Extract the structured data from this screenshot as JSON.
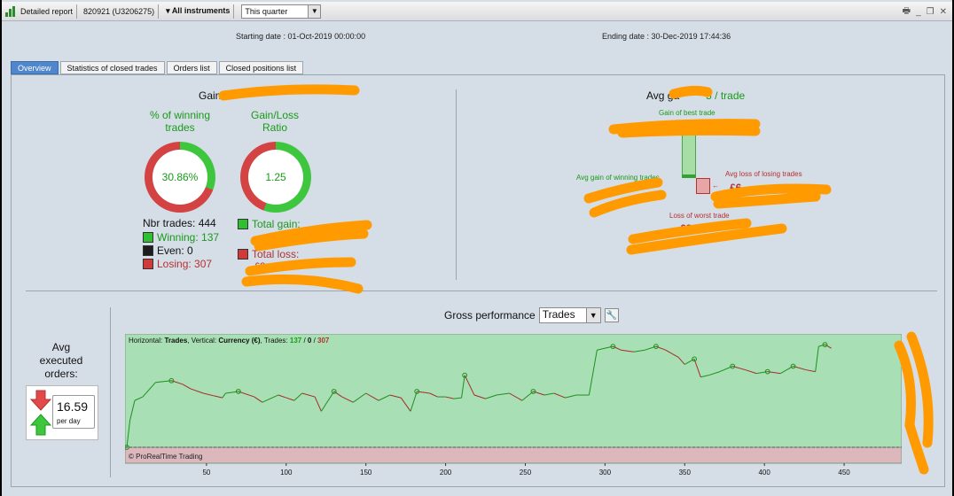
{
  "toolbar": {
    "title": "Detailed report",
    "account": "820921 (U3206275)",
    "instruments": "All instruments",
    "period": "This quarter"
  },
  "dates": {
    "start": "Starting date :  01-Oct-2019 00:00:00",
    "end": "Ending date :  30-Dec-2019 17:44:36"
  },
  "tabs": [
    "Overview",
    "Statistics of closed trades",
    "Orders list",
    "Closed positions list"
  ],
  "overview": {
    "gain_label": "Gain:",
    "winning_title": "% of winning trades",
    "ratio_title": "Gain/Loss Ratio",
    "winning_pct": "30.86%",
    "ratio_value": "1.25",
    "nbr_trades": "Nbr trades: 444",
    "winning": "Winning: 137",
    "even": "Even: 0",
    "losing": "Losing: 307",
    "total_gain": "Total gain:",
    "total_loss": "Total loss:",
    "total_loss_prefix": "£2",
    "winning_fraction": 0.3086,
    "ratio_fraction": 0.5555
  },
  "avg": {
    "title": "Avg ga",
    "title_suffix": "5 / trade",
    "gain_best": "Gain of best trade",
    "avg_gain_winning": "Avg gain of winning trades",
    "avg_loss_losing": "Avg loss of losing trades",
    "loss_worst": "Loss of worst trade",
    "loss_value_prefix": "£6",
    "worst_value_prefix": "£2"
  },
  "perf": {
    "title": "Gross performance",
    "mode": "Trades",
    "avg_exec_label": "Avg executed orders:",
    "per_day_value": "16.59",
    "per_day_unit": "per day"
  },
  "chart_label": {
    "h_prefix": "Horizontal: ",
    "h_value": "Trades",
    "v_prefix": ", Vertical: ",
    "v_value": "Currency (€)",
    "t_prefix": ", Trades: ",
    "t_win": "137",
    "t_sep1": " / ",
    "t_even": "0",
    "t_sep2": " / ",
    "t_lose": "307",
    "copyright": "© ProRealTime Trading"
  },
  "chart_data": {
    "type": "line",
    "x_ticks": [
      50,
      100,
      150,
      200,
      250,
      300,
      350,
      400,
      450
    ],
    "xlim": [
      0,
      485
    ],
    "series": [
      {
        "x": [
          0,
          2,
          5,
          10,
          18,
          28,
          35,
          40,
          48,
          55,
          60,
          62,
          70,
          80,
          85,
          95,
          100,
          105,
          110,
          118,
          122,
          130,
          135,
          142,
          150,
          158,
          165,
          172,
          178,
          182,
          190,
          195,
          200,
          205,
          210,
          212,
          218,
          225,
          232,
          240,
          248,
          255,
          262,
          268,
          275,
          282,
          290,
          292,
          295,
          300,
          305,
          310,
          318,
          325,
          332,
          338,
          342,
          346,
          350,
          356,
          360,
          365,
          372,
          380,
          388,
          395,
          402,
          410,
          418,
          426,
          432,
          434,
          438,
          442
        ],
        "y": [
          0,
          30,
          52,
          56,
          72,
          74,
          70,
          65,
          60,
          57,
          55,
          60,
          62,
          56,
          50,
          58,
          55,
          52,
          60,
          56,
          40,
          62,
          56,
          50,
          60,
          52,
          58,
          55,
          40,
          62,
          60,
          56,
          56,
          54,
          55,
          80,
          58,
          54,
          58,
          60,
          52,
          62,
          58,
          60,
          55,
          58,
          58,
          78,
          108,
          110,
          112,
          108,
          106,
          108,
          112,
          108,
          104,
          100,
          92,
          98,
          78,
          80,
          84,
          90,
          86,
          82,
          84,
          82,
          90,
          86,
          84,
          112,
          114,
          110
        ]
      }
    ]
  },
  "colors": {
    "green": "#1a9a1a",
    "red": "#b53030",
    "chart_bg": "#a9dfb4",
    "chart_neg": "#dcb7bc",
    "tab_active": "#4f86cc",
    "highlight": "#ff9a00"
  },
  "icons": [
    "chart-icon",
    "printer-icon",
    "minimize-icon",
    "restore-icon",
    "close-icon",
    "wrench-icon",
    "arrow-down-icon",
    "arrow-up-icon"
  ]
}
